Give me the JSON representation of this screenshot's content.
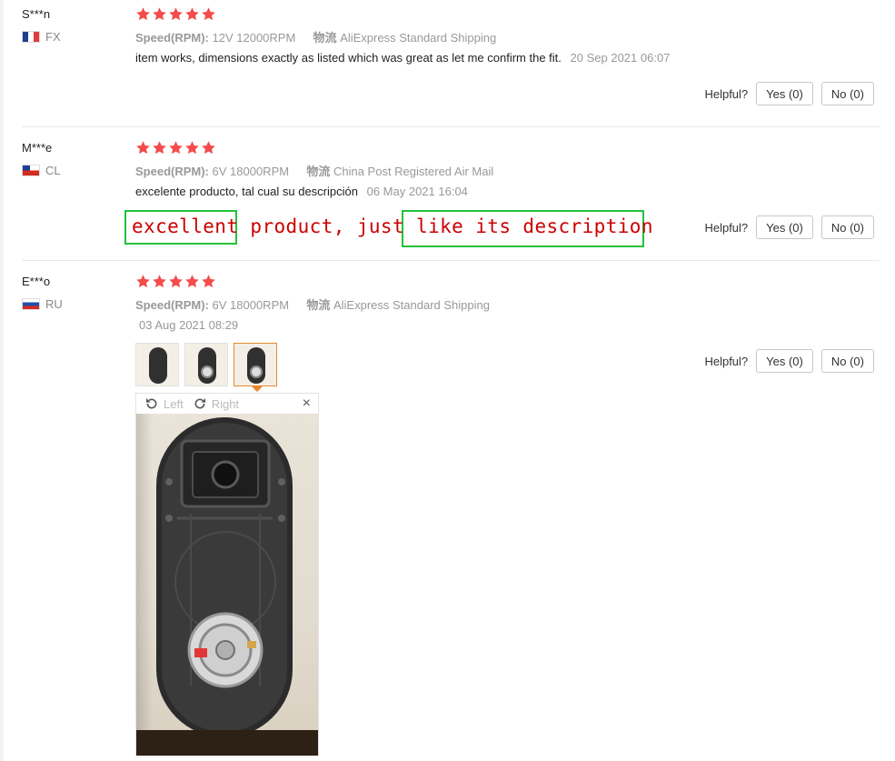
{
  "helpful_label": "Helpful?",
  "reviews": [
    {
      "user": "S***n",
      "country": "FX",
      "attr_key": "Speed(RPM):",
      "attr_value": "12V 12000RPM",
      "shipping_key": "物流",
      "shipping_value": "AliExpress Standard Shipping",
      "comment": "item works, dimensions exactly as listed which was great as let me confirm the fit.",
      "date": "20 Sep 2021 06:07",
      "yes": "Yes (0)",
      "no": "No (0)"
    },
    {
      "user": "M***e",
      "country": "CL",
      "attr_key": "Speed(RPM):",
      "attr_value": "6V 18000RPM",
      "shipping_key": "物流",
      "shipping_value": "China Post Registered Air Mail",
      "comment": "excelente producto, tal cual su descripción",
      "date": "06 May 2021 16:04",
      "translation": "excellent product, just like its description",
      "yes": "Yes (0)",
      "no": "No (0)"
    },
    {
      "user": "E***o",
      "country": "RU",
      "attr_key": "Speed(RPM):",
      "attr_value": "6V 18000RPM",
      "shipping_key": "物流",
      "shipping_value": "AliExpress Standard Shipping",
      "date": "03 Aug 2021 08:29",
      "yes": "Yes (0)",
      "no": "No (0)",
      "viewer": {
        "rotate_left": "Left",
        "rotate_right": "Right",
        "close": "×"
      }
    }
  ],
  "colors": {
    "star": "#f44b4b",
    "accent": "#e6892e",
    "box": "#23c23a",
    "translation": "#cc0000"
  },
  "icons": [
    "star-icon",
    "rotate-left-icon",
    "rotate-right-icon",
    "close-icon"
  ]
}
